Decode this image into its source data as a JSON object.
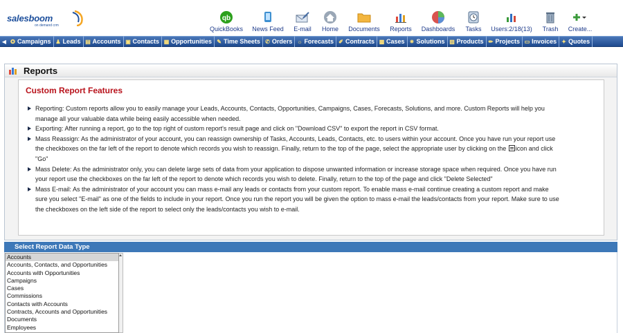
{
  "logo": {
    "brand_a": "sales",
    "brand_b": "boom",
    "tagline": "on demand crm"
  },
  "top_nav": [
    {
      "label": "QuickBooks",
      "icon": "quickbooks-icon"
    },
    {
      "label": "News Feed",
      "icon": "news-feed-icon"
    },
    {
      "label": "E-mail",
      "icon": "email-icon"
    },
    {
      "label": "Home",
      "icon": "home-icon"
    },
    {
      "label": "Documents",
      "icon": "documents-icon"
    },
    {
      "label": "Reports",
      "icon": "reports-icon"
    },
    {
      "label": "Dashboards",
      "icon": "dashboards-icon"
    },
    {
      "label": "Tasks",
      "icon": "tasks-icon"
    },
    {
      "label": "Users:2/18(13)",
      "icon": "users-icon"
    },
    {
      "label": "Trash",
      "icon": "trash-icon"
    },
    {
      "label": "Create...",
      "icon": "create-icon"
    }
  ],
  "tabs": [
    "Campaigns",
    "Leads",
    "Accounts",
    "Contacts",
    "Opportunities",
    "Time Sheets",
    "Orders",
    "Forecasts",
    "Contracts",
    "Cases",
    "Solutions",
    "Products",
    "Projects",
    "Invoices",
    "Quotes"
  ],
  "reports_panel": {
    "title": "Reports"
  },
  "features": {
    "heading": "Custom Report Features",
    "items": [
      "Reporting: Custom reports allow you to easily manage your Leads, Accounts, Contacts, Opportunities, Campaigns, Cases, Forecasts, Solutions, and more. Custom Reports will help you manage all your valuable data while being easily accessible when needed.",
      "Exporting: After running a report, go to the top right of custom report's result page and click on \"Download CSV\" to export the report in CSV format.",
      "Mass Reassign: As the administrator of your account, you can reassign ownership of Tasks, Accounts, Leads, Contacts, etc. to users within your account. Once you have run your report use the checkboxes on the far left of the report to denote which records you wish to reassign. Finally, return to the top of the page, select the appropriate user by clicking on the",
      "icon and click \"Go\"",
      "Mass Delete: As the administrator only, you can delete large sets of data from your application to dispose unwanted information or increase storage space when required. Once you have run your report use the checkboxes on the far left of the report to denote which records you wish to delete. Finally, return to the top of the page and click \"Delete Selected\"",
      "Mass E-mail: As the administrator of your account you can mass e-mail any leads or contacts from your custom report. To enable mass e-mail continue creating a custom report and make sure you select \"E-mail\" as one of the fields to include in your report. Once you run the report you will be given the option to mass e-mail the leads/contacts from your report. Make sure to use the checkboxes on the left side of the report to select only the leads/contacts you wish to e-mail."
    ]
  },
  "report_data_type": {
    "heading": "Select Report Data Type",
    "selected": "Accounts",
    "options": [
      "Accounts",
      "Accounts, Contacts, and Opportunities",
      "Accounts with Opportunities",
      "Campaigns",
      "Cases",
      "Commissions",
      "Contacts with Accounts",
      "Contracts, Accounts and Opportunities",
      "Documents",
      "Employees"
    ]
  }
}
